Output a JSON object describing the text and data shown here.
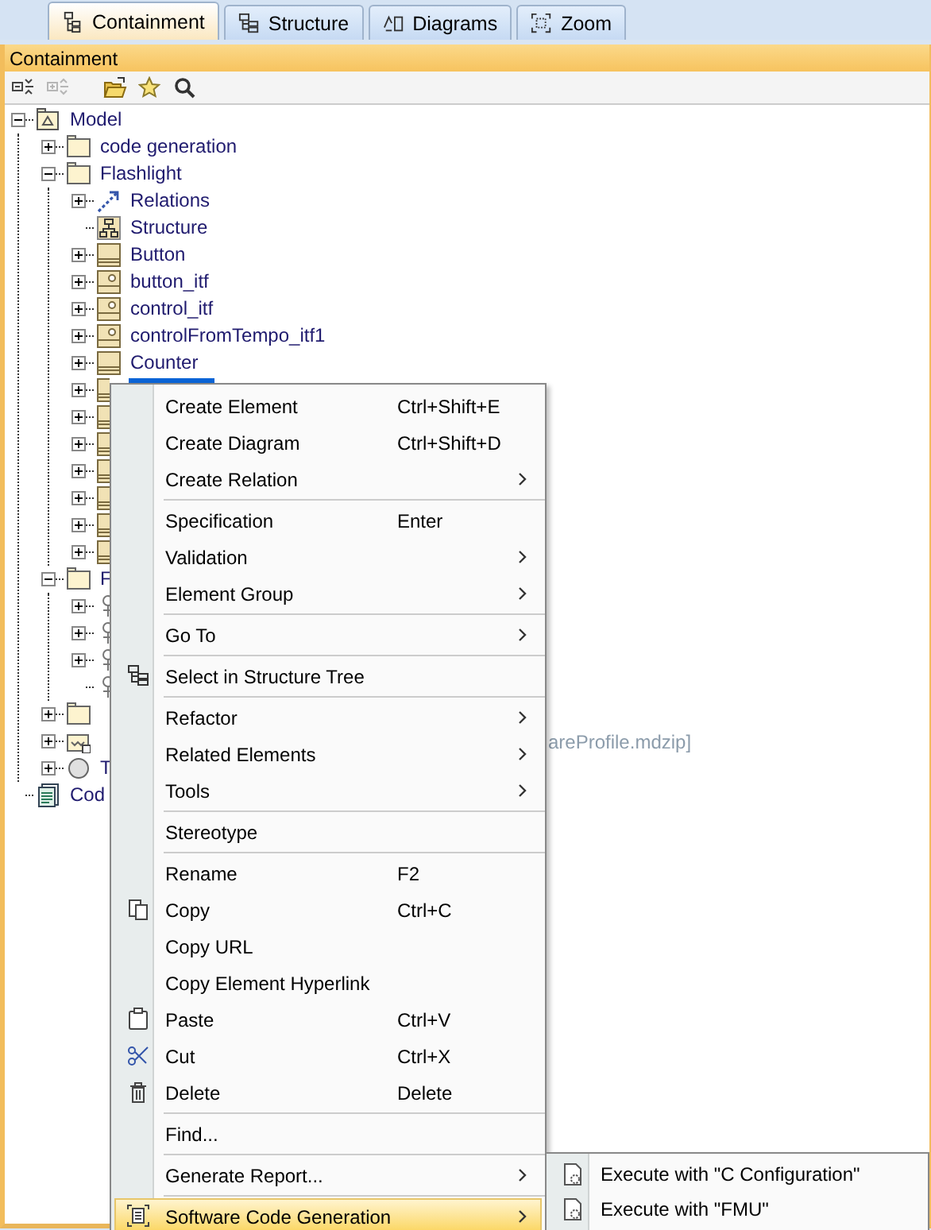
{
  "tabs": [
    {
      "label": "Containment",
      "selected": true
    },
    {
      "label": "Structure",
      "selected": false
    },
    {
      "label": "Diagrams",
      "selected": false
    },
    {
      "label": "Zoom",
      "selected": false
    }
  ],
  "panel": {
    "title": "Containment",
    "toolbar": [
      {
        "disabled": false
      },
      {
        "disabled": true
      },
      {
        "disabled": false
      },
      {
        "disabled": false
      },
      {
        "disabled": false
      }
    ]
  },
  "tree": [
    {
      "label": "Model",
      "kind": "model",
      "expanded": true,
      "selected": false,
      "disabled": false,
      "children": [
        {
          "label": "code generation",
          "kind": "folder",
          "expanded": false,
          "selected": false,
          "disabled": false
        },
        {
          "label": "Flashlight",
          "kind": "folder",
          "expanded": true,
          "selected": false,
          "disabled": false,
          "children": [
            {
              "label": "Relations",
              "kind": "relations",
              "expanded": false,
              "selected": false,
              "disabled": false
            },
            {
              "label": "Structure",
              "kind": "diagram",
              "selected": false,
              "disabled": false
            },
            {
              "label": "Button",
              "kind": "block",
              "expanded": false,
              "selected": false,
              "disabled": false
            },
            {
              "label": "button_itf",
              "kind": "interface",
              "expanded": false,
              "selected": false,
              "disabled": false
            },
            {
              "label": "control_itf",
              "kind": "interface",
              "expanded": false,
              "selected": false,
              "disabled": false
            },
            {
              "label": "controlFromTempo_itf1",
              "kind": "interface",
              "expanded": false,
              "selected": false,
              "disabled": false
            },
            {
              "label": "Counter",
              "kind": "block",
              "expanded": false,
              "selected": false,
              "disabled": false
            },
            {
              "kind": "block",
              "expanded": false,
              "selected": true
            },
            {
              "kind": "block",
              "expanded": false
            },
            {
              "kind": "block",
              "expanded": false
            },
            {
              "kind": "block",
              "expanded": false
            },
            {
              "kind": "block",
              "expanded": false
            },
            {
              "kind": "block",
              "expanded": false
            },
            {
              "kind": "block",
              "expanded": false
            }
          ]
        },
        {
          "label": "F",
          "kind": "folder",
          "expanded": true,
          "selected": false,
          "disabled": false,
          "children": [
            {
              "kind": "pin",
              "expanded": false
            },
            {
              "kind": "pin",
              "expanded": false
            },
            {
              "kind": "pin",
              "expanded": false
            },
            {
              "kind": "pin"
            }
          ]
        },
        {
          "kind": "folder",
          "expanded": false
        },
        {
          "suffix": "areProfile.mdzip]",
          "kind": "profile",
          "expanded": false,
          "disabled": true
        },
        {
          "label": "T",
          "kind": "circle",
          "expanded": false,
          "selected": false,
          "disabled": false
        }
      ]
    },
    {
      "label": "Cod",
      "kind": "code",
      "selected": false,
      "disabled": false
    }
  ],
  "context_menu": {
    "groups": [
      [
        {
          "label": "Create Element",
          "shortcut": "Ctrl+Shift+E",
          "submenu": false,
          "selected": false
        },
        {
          "label": "Create Diagram",
          "shortcut": "Ctrl+Shift+D",
          "submenu": false,
          "selected": false
        },
        {
          "label": "Create Relation",
          "submenu": true,
          "selected": false
        }
      ],
      [
        {
          "label": "Specification",
          "shortcut": "Enter",
          "submenu": false,
          "selected": false
        },
        {
          "label": "Validation",
          "submenu": true,
          "selected": false
        },
        {
          "label": "Element Group",
          "submenu": true,
          "selected": false
        }
      ],
      [
        {
          "label": "Go To",
          "submenu": true,
          "selected": false
        }
      ],
      [
        {
          "label": "Select in Structure Tree",
          "kind": "structure-tree",
          "submenu": false,
          "selected": false
        }
      ],
      [
        {
          "label": "Refactor",
          "submenu": true,
          "selected": false
        },
        {
          "label": "Related Elements",
          "submenu": true,
          "selected": false
        },
        {
          "label": "Tools",
          "submenu": true,
          "selected": false
        }
      ],
      [
        {
          "label": "Stereotype",
          "submenu": false,
          "selected": false
        }
      ],
      [
        {
          "label": "Rename",
          "shortcut": "F2",
          "submenu": false,
          "selected": false
        },
        {
          "label": "Copy",
          "shortcut": "Ctrl+C",
          "kind": "copy",
          "submenu": false,
          "selected": false
        },
        {
          "label": "Copy URL",
          "submenu": false,
          "selected": false
        },
        {
          "label": "Copy Element Hyperlink",
          "submenu": false,
          "selected": false
        },
        {
          "label": "Paste",
          "shortcut": "Ctrl+V",
          "kind": "paste",
          "submenu": false,
          "selected": false
        },
        {
          "label": "Cut",
          "shortcut": "Ctrl+X",
          "kind": "cut",
          "submenu": false,
          "selected": false
        },
        {
          "label": "Delete",
          "shortcut": "Delete",
          "kind": "delete",
          "submenu": false,
          "selected": false
        }
      ],
      [
        {
          "label": "Find...",
          "submenu": false,
          "selected": false
        }
      ],
      [
        {
          "label": "Generate Report...",
          "submenu": true,
          "selected": false
        }
      ],
      [
        {
          "label": "Software Code Generation",
          "kind": "code-generation",
          "submenu": true,
          "selected": true
        }
      ]
    ]
  },
  "submenu": {
    "items": [
      {
        "label": "Execute with \"C Configuration\"",
        "kind": "execute"
      },
      {
        "label": "Execute with \"FMU\"",
        "kind": "execute"
      }
    ]
  }
}
